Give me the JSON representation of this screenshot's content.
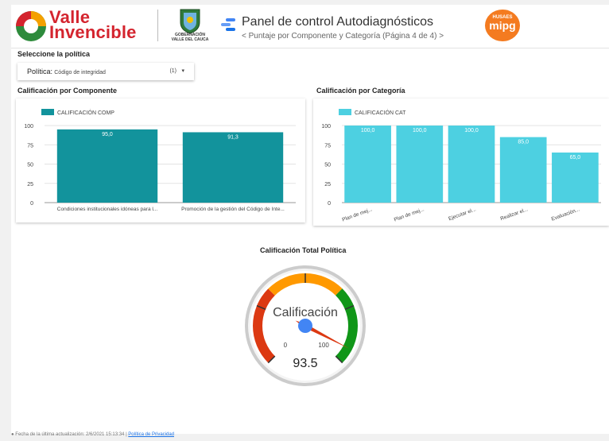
{
  "header": {
    "brand_line1": "Valle",
    "brand_line2": "Invencible",
    "gob_text": "GOBERNACIÓN VALLE DEL CAUCA",
    "title": "Panel de control Autodiagnósticos",
    "subtitle": "Puntaje por Componente y Categoría (Página 4 de 4)",
    "prev_arrow": "<",
    "next_arrow": ">",
    "mipg_top": "HUSAES",
    "mipg_main": "mipg"
  },
  "filter": {
    "section_label": "Seleccione la política",
    "key": "Política:",
    "value": "Código de integridad",
    "count": "(1)",
    "caret": "▾"
  },
  "charts": {
    "component_title": "Calificación por Componente",
    "category_title": "Calificación por Categoría",
    "gauge_title": "Calificación Total Política"
  },
  "chart_data": [
    {
      "type": "bar",
      "legend": "CALIFICACIÓN COMP",
      "color": "#12939c",
      "categories": [
        "Condiciones institucionales idóneas para l...",
        "Promoción de la gestión del Código de Inte..."
      ],
      "values": [
        95.0,
        91.3
      ],
      "value_labels": [
        "95,0",
        "91,3"
      ],
      "yticks": [
        "0",
        "25",
        "50",
        "75",
        "100"
      ],
      "ylim": [
        0,
        100
      ]
    },
    {
      "type": "bar",
      "legend": "CALIFICACIÓN CAT",
      "color": "#4dd0e1",
      "categories": [
        "Plan de mej...",
        "Plan de mej...",
        "Ejecutar el...",
        "Realizar el...",
        "Evaluación..."
      ],
      "values": [
        100.0,
        100.0,
        100.0,
        85.0,
        65.0
      ],
      "value_labels": [
        "100,0",
        "100,0",
        "100,0",
        "85,0",
        "65,0"
      ],
      "yticks": [
        "0",
        "25",
        "50",
        "75",
        "100"
      ],
      "ylim": [
        0,
        100
      ]
    },
    {
      "type": "gauge",
      "label": "Calificación",
      "value": 93.5,
      "value_label": "93.5",
      "min_label": "0",
      "max_label": "100",
      "colors": {
        "red": "#dc3912",
        "orange": "#ff9900",
        "green": "#109618",
        "needle": "#dc3912",
        "hub": "#4285f4"
      }
    }
  ],
  "footer": {
    "updated": "Fecha de la última actualización: 2/6/2021 15:13:34",
    "separator": "|",
    "privacy": "Política de Privacidad"
  }
}
